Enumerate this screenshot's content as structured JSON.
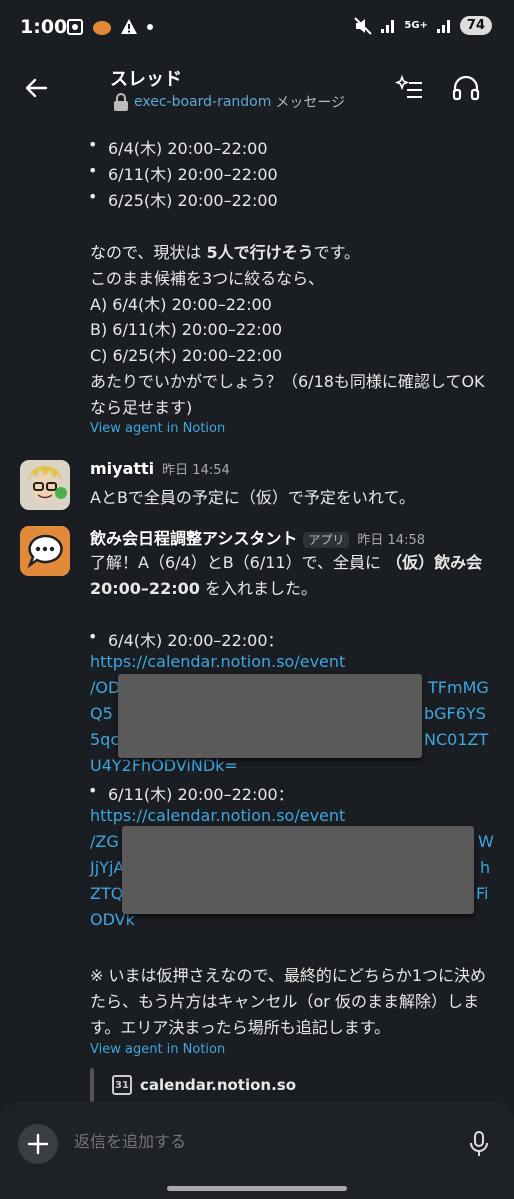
{
  "status": {
    "time": "1:00",
    "battery": "74",
    "network": "5G+"
  },
  "header": {
    "title": "スレッド",
    "channel": "exec-board-random",
    "suffix": "メッセージ"
  },
  "msg1": {
    "bullets": [
      "6/4(木) 20:00–22:00",
      "6/11(木) 20:00–22:00",
      "6/25(木) 20:00–22:00"
    ],
    "line_pre": "なので、現状は ",
    "line_bold": "5人で行けそう",
    "line_post": "です。",
    "line2": "このまま候補を3つに絞るなら、",
    "optA": "A) 6/4(木) 20:00–22:00",
    "optB": "B) 6/11(木) 20:00–22:00",
    "optC": "C) 6/25(木) 20:00–22:00",
    "ask1": "あたりでいかがでしょう？（6/18も同様に確認してOK",
    "ask2": "なら足せます)",
    "agent_link": "View agent in Notion"
  },
  "msg2": {
    "user": "miyatti",
    "time": "昨日 14:54",
    "text": "AとBで全員の予定に（仮）で予定をいれて。"
  },
  "msg3": {
    "user": "飲み会日程調整アシスタント",
    "badge": "アプリ",
    "time": "昨日 14:58",
    "l1_pre": "了解！A（6/4）とB（6/11）で、全員に ",
    "l1_bold": "（仮）飲み会",
    "l2_bold": "20:00–22:00",
    "l2_post": " を入れました。",
    "b1": "6/4(木) 20:00–22:00：",
    "b1_url": [
      "https://calendar.notion.so/event",
      "/OD",
      "TFmMG",
      "Q5",
      "bGF6YS",
      "5qc",
      "NC01ZT",
      "U4Y2FhODViNDk="
    ],
    "b2": "6/11(木) 20:00–22:00：",
    "b2_url": [
      "https://calendar.notion.so/event",
      "/ZG",
      "W",
      "JjYjA",
      "h",
      "ZTQ",
      "Fi",
      "ODVk"
    ],
    "note1": "※ いまは仮押さえなので、最終的にどちらか1つに決め",
    "note2": "たら、もう片方はキャンセル（or 仮のまま解除）しま",
    "note3": "す。エリア決まったら場所も追記します。",
    "agent_link": "View agent in Notion",
    "preview_domain": "calendar.notion.so",
    "cal_num": "31"
  },
  "composer": {
    "placeholder": "返信を追加する"
  },
  "colors": {
    "bg": "#1a1d21",
    "link": "#3ea7e0",
    "accent_orange": "#e38a3a"
  }
}
